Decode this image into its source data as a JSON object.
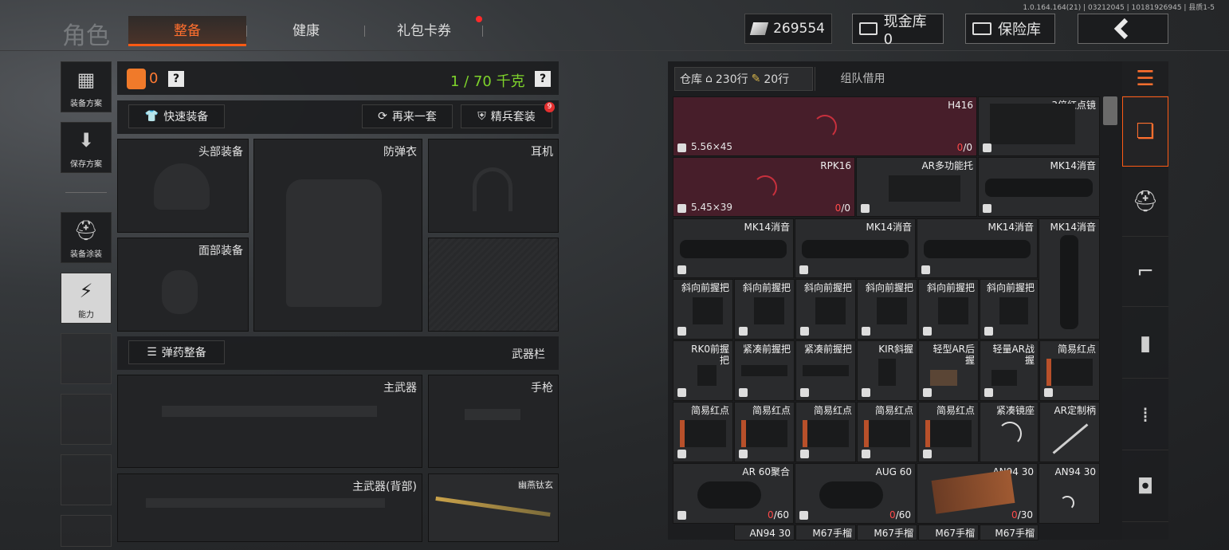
{
  "version": "1.0.164.164(21) | 03212045 | 10181926945 | 县质1-5",
  "brand": "角色",
  "tabs": [
    "整备",
    "健康",
    "礼包卡券"
  ],
  "topbar": {
    "money": "269554",
    "cash_vault": "现金库 0",
    "safe_box": "保险库"
  },
  "sidebar": {
    "scheme": "装备方案",
    "save": "保存方案",
    "skin": "装备涂装",
    "ability": "能力"
  },
  "equipment": {
    "armor_count": "0",
    "weight": "1 / 70 千克",
    "help": "?",
    "quick_equip": "快速装备",
    "another_set": "再来一套",
    "elite_set": "精兵套装",
    "elite_badge": "9",
    "ammo_prep": "弹药整备",
    "weapon_bar": "武器栏",
    "slots": {
      "head": "头部装备",
      "vest": "防弹衣",
      "earphone": "耳机",
      "face": "面部装备",
      "primary": "主武器",
      "pistol": "手枪",
      "primary_back": "主武器(背部)",
      "melee": "幽燕钛玄"
    }
  },
  "warehouse": {
    "tab": "仓库",
    "rows": "230行",
    "extra_rows": "20行",
    "team_borrow": "组队借用",
    "items": {
      "h416": {
        "name": "H416",
        "caliber": "5.56×45",
        "count_zero": "0",
        "count_rest": "/0"
      },
      "scope3x": {
        "name": "3倍红点镜"
      },
      "rpk16": {
        "name": "RPK16",
        "caliber": "5.45×39",
        "count_zero": "0",
        "count_rest": "/0"
      },
      "ar_stock": {
        "name": "AR多功能托"
      },
      "mk14": {
        "name": "MK14消音"
      },
      "angled_grip": {
        "name": "斜向前握把"
      },
      "rk0": {
        "name": "RK0前握\n把"
      },
      "jl_grip": {
        "name": "紧凑前握把"
      },
      "kir": {
        "name": "KIR斜握"
      },
      "light_ar_rear": {
        "name": "轻型AR后\n握"
      },
      "light_ar_battle": {
        "name": "轻量AR战\n握"
      },
      "simple_red": {
        "name": "简易红点"
      },
      "jl_mount": {
        "name": "紧凑镜座"
      },
      "ar_custom": {
        "name": "AR定制柄"
      },
      "ar60": {
        "name": "AR 60聚合",
        "count_zero": "0",
        "count_rest": "/60"
      },
      "aug60": {
        "name": "AUG 60",
        "count_zero": "0",
        "count_rest": "/60"
      },
      "an94": {
        "name": "AN94 30",
        "count_zero": "0",
        "count_rest": "/30"
      },
      "m67": {
        "name": "M67手榴"
      }
    }
  }
}
